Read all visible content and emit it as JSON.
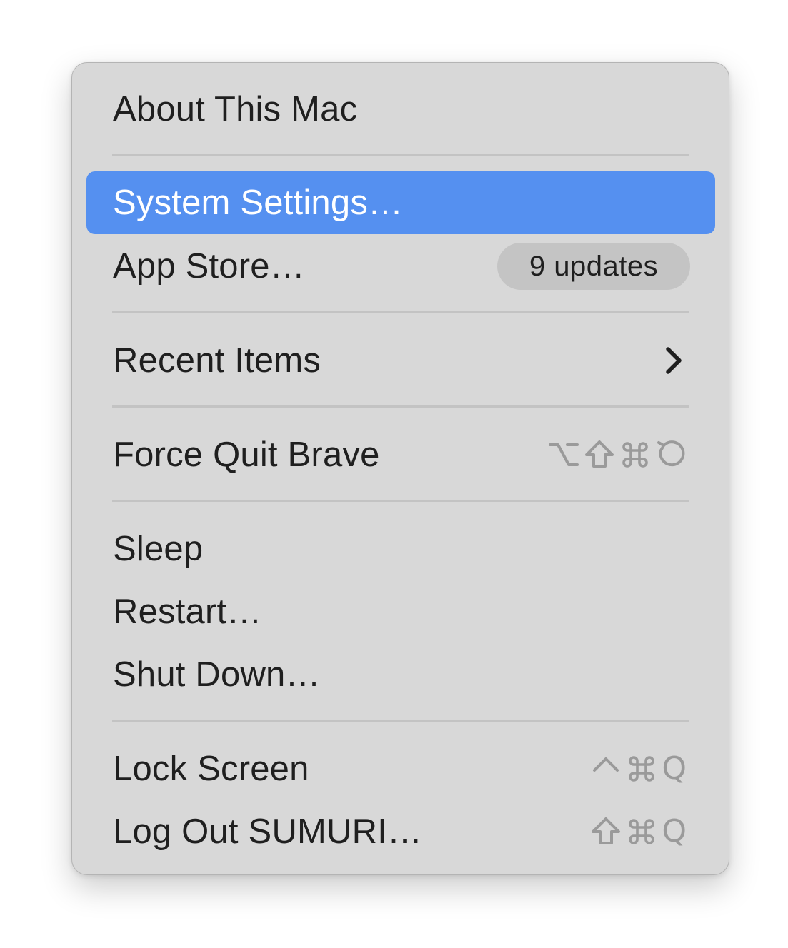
{
  "menu": {
    "about": "About This Mac",
    "system_settings": "System Settings…",
    "app_store": "App Store…",
    "app_store_badge": "9 updates",
    "recent_items": "Recent Items",
    "force_quit": "Force Quit Brave",
    "sleep": "Sleep",
    "restart": "Restart…",
    "shut_down": "Shut Down…",
    "lock_screen": "Lock Screen",
    "log_out": "Log Out SUMURI…"
  },
  "shortcuts": {
    "force_quit": [
      "option-key-icon",
      "shift-key-icon",
      "command-key-icon",
      "escape-key-icon"
    ],
    "lock_screen": [
      "control-key-icon",
      "command-key-icon",
      "Q"
    ],
    "log_out": [
      "shift-key-icon",
      "command-key-icon",
      "Q"
    ]
  },
  "icons": {
    "recent_items": "chevron-right-icon"
  },
  "colors": {
    "menu_background": "#d8d8d8",
    "selection": "#5590f0",
    "text": "#1f1f1f",
    "shortcut_text": "#9a9a9a",
    "badge_background": "#c4c4c4"
  }
}
